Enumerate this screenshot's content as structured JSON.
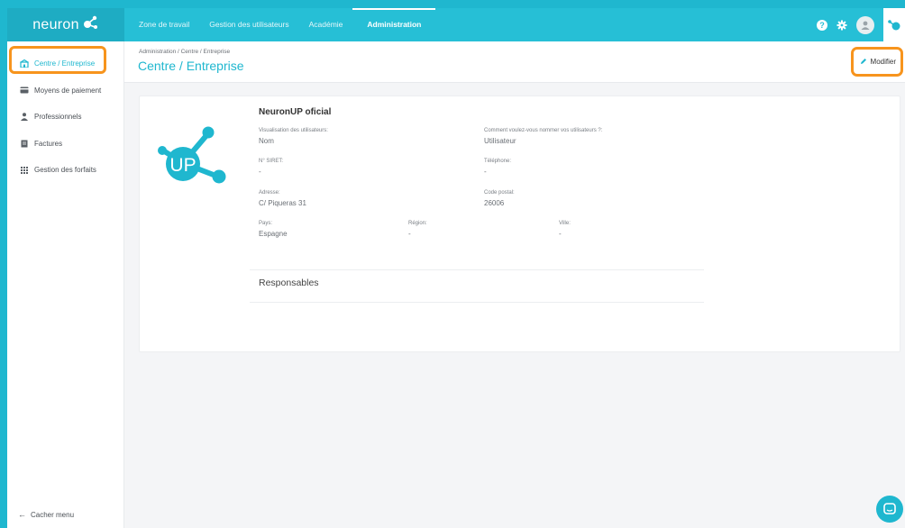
{
  "brand": {
    "name": "neuron"
  },
  "nav": {
    "items": [
      {
        "label": "Zone de travail"
      },
      {
        "label": "Gestion des utilisateurs"
      },
      {
        "label": "Académie"
      },
      {
        "label": "Administration",
        "active": true
      }
    ]
  },
  "topbar": {
    "help_glyph": "?",
    "icons": [
      "help-icon",
      "gear-icon",
      "avatar-icon",
      "app-logo-icon"
    ]
  },
  "sidebar": {
    "items": [
      {
        "label": "Centre / Entreprise",
        "icon": "building-icon",
        "active": true
      },
      {
        "label": "Moyens de paiement",
        "icon": "credit-card-icon"
      },
      {
        "label": "Professionnels",
        "icon": "person-icon"
      },
      {
        "label": "Factures",
        "icon": "invoice-icon"
      },
      {
        "label": "Gestion des forfaits",
        "icon": "grid-icon"
      }
    ],
    "hide_menu": "Cacher menu"
  },
  "header": {
    "breadcrumb": "Administration / Centre / Entreprise",
    "title": "Centre / Entreprise",
    "modify_label": "Modifier"
  },
  "card": {
    "org_name": "NeuronUP oficial",
    "logo_text": "UP",
    "fields": {
      "visualisation": {
        "label": "Visualisation des utilisateurs:",
        "value": "Nom"
      },
      "naming": {
        "label": "Comment voulez-vous nommer vos utilisateurs ?:",
        "value": "Utilisateur"
      },
      "siret": {
        "label": "N° SIRET:",
        "value": "-"
      },
      "telephone": {
        "label": "Téléphone:",
        "value": "-"
      },
      "adresse": {
        "label": "Adresse:",
        "value": "C/ Piqueras 31"
      },
      "code_postal": {
        "label": "Code postal:",
        "value": "26006"
      },
      "pays": {
        "label": "Pays:",
        "value": "Espagne"
      },
      "region": {
        "label": "Région:",
        "value": "-"
      },
      "ville": {
        "label": "Ville:",
        "value": "-"
      }
    },
    "responsables_title": "Responsables"
  },
  "colors": {
    "accent": "#1fb7cf",
    "highlight": "#f7941d",
    "topbar": "#26bfd6"
  }
}
